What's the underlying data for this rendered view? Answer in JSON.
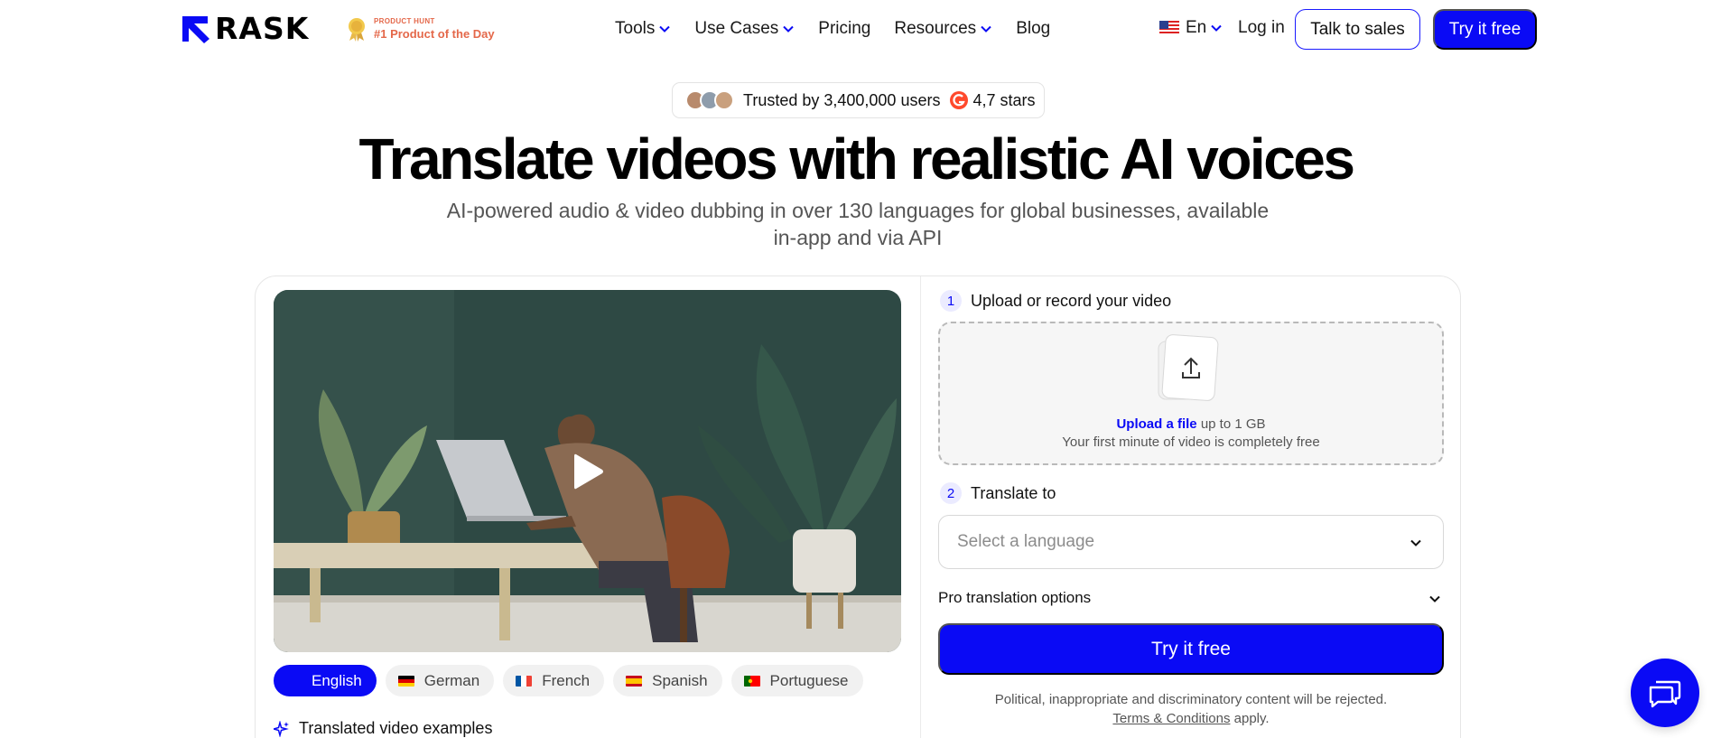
{
  "header": {
    "logo_text": "RASK",
    "product_hunt": {
      "small": "PRODUCT HUNT",
      "big": "#1 Product of the Day"
    },
    "nav": [
      {
        "label": "Tools",
        "has_dropdown": true
      },
      {
        "label": "Use Cases",
        "has_dropdown": true
      },
      {
        "label": "Pricing",
        "has_dropdown": false
      },
      {
        "label": "Resources",
        "has_dropdown": true
      },
      {
        "label": "Blog",
        "has_dropdown": false
      }
    ],
    "language": "En",
    "login": "Log in",
    "talk_to_sales": "Talk to sales",
    "try_free": "Try it free"
  },
  "hero": {
    "trust_text": "Trusted by 3,400,000 users",
    "rating_text": "4,7 stars",
    "title": "Translate videos with realistic AI voices",
    "subtitle": "AI-powered audio & video dubbing in over 130 languages for global businesses, available in-app and via API"
  },
  "demo": {
    "languages": [
      {
        "label": "English",
        "active": true
      },
      {
        "label": "German",
        "active": false
      },
      {
        "label": "French",
        "active": false
      },
      {
        "label": "Spanish",
        "active": false
      },
      {
        "label": "Portuguese",
        "active": false
      }
    ],
    "examples_label": "Translated video examples"
  },
  "form": {
    "step1": {
      "number": "1",
      "label": "Upload or record your video"
    },
    "upload_link": "Upload a file",
    "upload_limit": "up to 1 GB",
    "upload_note": "Your first minute of video is completely free",
    "step2": {
      "number": "2",
      "label": "Translate to"
    },
    "select_placeholder": "Select a language",
    "pro_options": "Pro translation options",
    "try_free": "Try it free",
    "disclaimer": "Political, inappropriate and discriminatory content will be rejected.",
    "terms": "Terms & Conditions",
    "terms_suffix": "apply."
  },
  "colors": {
    "accent": "#0a0af5",
    "product_hunt": "#e4684a"
  }
}
